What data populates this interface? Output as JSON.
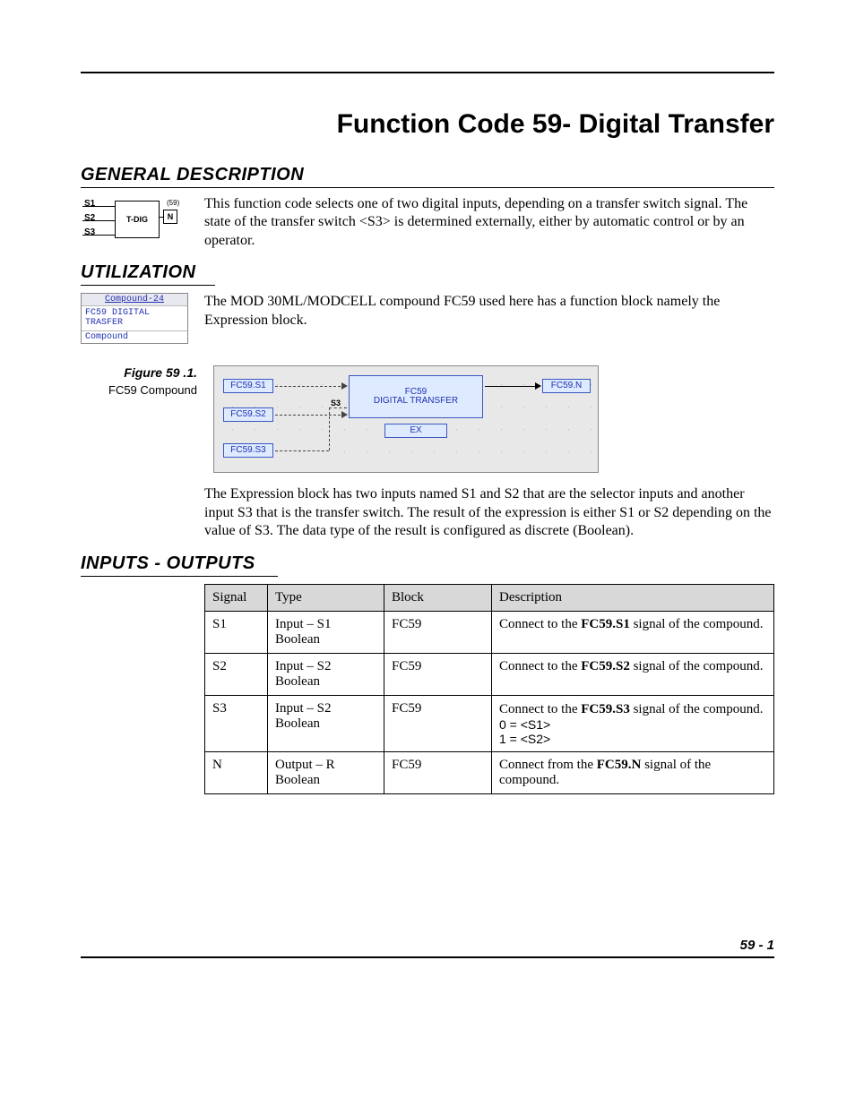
{
  "title": "Function Code 59- Digital Transfer",
  "sections": {
    "general": "GENERAL DESCRIPTION",
    "utilization": "UTILIZATION",
    "io": "INPUTS - OUTPUTS"
  },
  "tdig": {
    "s1": "S1",
    "s2": "S2",
    "s3": "S3",
    "label": "T-DIG",
    "code": "(59)",
    "out": "N"
  },
  "general_text": "This function code selects one of two digital inputs, depending on a transfer switch signal. The state of the transfer switch <S3> is determined externally, either by automatic control or by an operator.",
  "compound_icon": {
    "hdr": "Compound-24",
    "line1": "FC59   DIGITAL",
    "line2": "TRASFER",
    "foot": "Compound"
  },
  "utilization_text": "The MOD 30ML/MODCELL compound FC59 used here has a function block namely the Expression block.",
  "figure": {
    "num": "Figure 59 .1.",
    "caption": "FC59 Compound"
  },
  "diagram": {
    "s1": "FC59.S1",
    "s2": "FC59.S2",
    "s3": "FC59.S3",
    "main_top": "FC59",
    "main_bottom": "DIGITAL TRANSFER",
    "ex": "EX",
    "out": "FC59.N",
    "s3_lbl": "S3"
  },
  "expression_text": "The Expression block has two inputs named S1 and S2 that are the selector inputs and another input S3 that is the transfer switch. The result of the expression is either S1 or S2 depending on the value of S3. The data type of the result is configured as discrete (Boolean).",
  "table": {
    "headers": {
      "c1": "Signal",
      "c2": "Type",
      "c3": "Block",
      "c4": "Description"
    },
    "rows": [
      {
        "signal": "S1",
        "type": "Input – S1 Boolean",
        "block": "FC59",
        "desc_pre": "Connect to the ",
        "desc_bold": "FC59.S1",
        "desc_post": " signal of the compound."
      },
      {
        "signal": "S2",
        "type": "Input – S2 Boolean",
        "block": "FC59",
        "desc_pre": "Connect to the ",
        "desc_bold": "FC59.S2",
        "desc_post": " signal of the compound."
      },
      {
        "signal": "S3",
        "type": "Input – S2 Boolean",
        "block": "FC59",
        "desc_pre": "Connect to the ",
        "desc_bold": "FC59.S3",
        "desc_post": " signal of the compound.",
        "extra1": "0 = <S1>",
        "extra2": "1 = <S2>"
      },
      {
        "signal": "N",
        "type": "Output – R Boolean",
        "block": "FC59",
        "desc_pre": "Connect from the ",
        "desc_bold": "FC59.N",
        "desc_post": " signal of the compound."
      }
    ]
  },
  "page_number": "59 - 1"
}
